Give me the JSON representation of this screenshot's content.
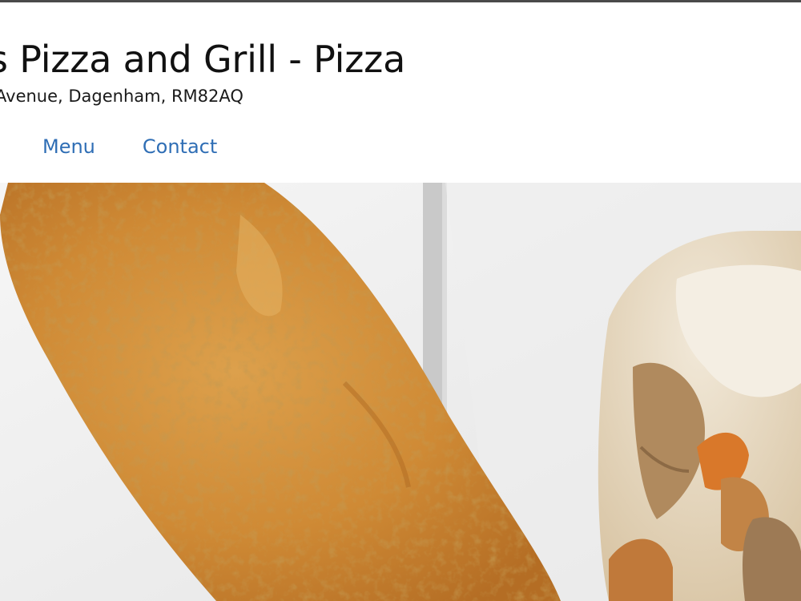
{
  "header": {
    "title": "s Pizza and Grill - Pizza",
    "address": "Avenue, Dagenham, RM82AQ"
  },
  "nav": {
    "items": [
      {
        "label": "Menu"
      },
      {
        "label": "Contact"
      }
    ]
  },
  "colors": {
    "link": "#2f6eb5",
    "top_border": "#4a4a4a",
    "tray": "#f3f3f3",
    "fish_batter": "#d9963f",
    "wrap": "#e9ddc9"
  },
  "hero": {
    "image": "fried-fish-and-kebab-wrap-photo"
  }
}
